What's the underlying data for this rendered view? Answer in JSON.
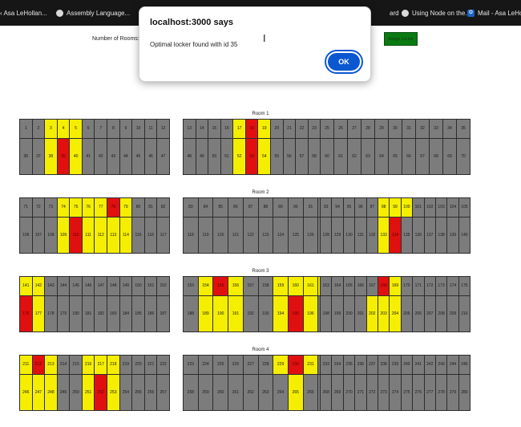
{
  "bookmarks": [
    {
      "label": "‹ Asa LeHollan...",
      "icon": "globe-icon"
    },
    {
      "label": "Assembly Language...",
      "icon": "globe-icon"
    },
    {
      "label": "ard",
      "icon": ""
    },
    {
      "label": "Using Node on the...",
      "icon": "globe-icon"
    },
    {
      "label": "Mail - Asa LeHo...",
      "icon": "outlook-icon"
    }
  ],
  "form": {
    "rooms_label": "Number of Rooms:",
    "assign_button": "Assign Locker"
  },
  "dialog": {
    "title": "localhost:3000 says",
    "message": "Optimal locker found with id 35",
    "ok_label": "OK"
  },
  "cursor_glyph": "I",
  "colors": {
    "locker_empty": "#7c7c7c",
    "locker_available": "#f5ee00",
    "locker_chosen": "#e01010",
    "assign_button": "#0a7a12",
    "dialog_ok": "#0b57d0"
  },
  "rooms": [
    {
      "title": "Room 1",
      "banks": [
        {
          "start": 1,
          "count": 12,
          "available": [
            3,
            4,
            5,
            38,
            40
          ],
          "chosen": [
            39
          ]
        },
        {
          "start": 13,
          "count": 12,
          "available": [
            17,
            19,
            52,
            54
          ],
          "chosen": [
            18,
            53
          ]
        },
        {
          "start": 25,
          "count": 11,
          "available": [],
          "chosen": []
        }
      ]
    },
    {
      "title": "Room 2",
      "banks": [
        {
          "start": 71,
          "count": 12,
          "available": [
            74,
            75,
            76,
            77,
            79,
            109,
            111,
            112,
            113,
            114
          ],
          "chosen": [
            78,
            110
          ]
        },
        {
          "start": 83,
          "count": 10,
          "available": [],
          "chosen": []
        },
        {
          "start": 93,
          "count": 13,
          "available": [
            98,
            99,
            100,
            133
          ],
          "chosen": [
            134
          ]
        }
      ]
    },
    {
      "title": "Room 3",
      "banks": [
        {
          "start": 141,
          "count": 12,
          "available": [
            141,
            142,
            177
          ],
          "chosen": [
            176
          ]
        },
        {
          "start": 153,
          "count": 10,
          "available": [
            154,
            156,
            159,
            160,
            161,
            162,
            189,
            190,
            191,
            194,
            196
          ],
          "chosen": [
            155,
            195
          ]
        },
        {
          "start": 163,
          "count": 13,
          "available": [
            169,
            202,
            203,
            204
          ],
          "chosen": [
            168
          ]
        }
      ]
    },
    {
      "title": "Room 4",
      "banks": [
        {
          "start": 211,
          "count": 12,
          "available": [
            211,
            213,
            216,
            217,
            218,
            246,
            247,
            248,
            251,
            253
          ],
          "chosen": [
            212,
            252
          ]
        },
        {
          "start": 223,
          "count": 10,
          "available": [
            229,
            231,
            265
          ],
          "chosen": [
            230
          ]
        },
        {
          "start": 233,
          "count": 13,
          "available": [],
          "chosen": []
        }
      ]
    }
  ]
}
